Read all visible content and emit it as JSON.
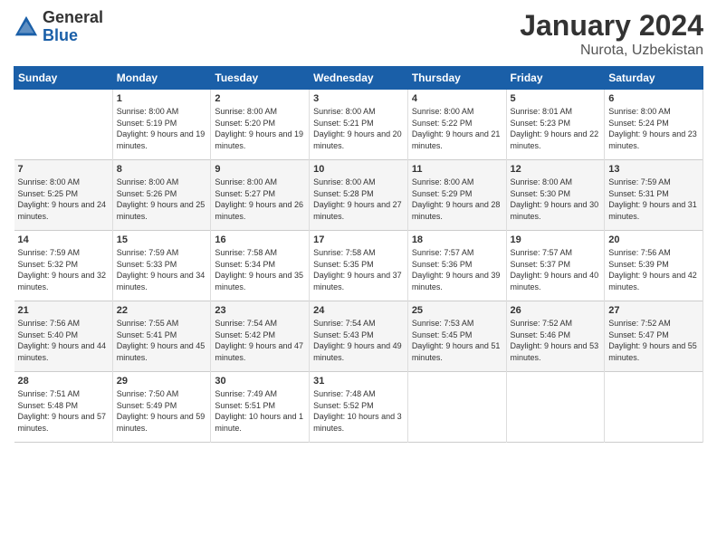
{
  "header": {
    "logo_general": "General",
    "logo_blue": "Blue",
    "month_title": "January 2024",
    "location": "Nurota, Uzbekistan"
  },
  "weekdays": [
    "Sunday",
    "Monday",
    "Tuesday",
    "Wednesday",
    "Thursday",
    "Friday",
    "Saturday"
  ],
  "weeks": [
    [
      {
        "day": "",
        "sunrise": "",
        "sunset": "",
        "daylight": ""
      },
      {
        "day": "1",
        "sunrise": "Sunrise: 8:00 AM",
        "sunset": "Sunset: 5:19 PM",
        "daylight": "Daylight: 9 hours and 19 minutes."
      },
      {
        "day": "2",
        "sunrise": "Sunrise: 8:00 AM",
        "sunset": "Sunset: 5:20 PM",
        "daylight": "Daylight: 9 hours and 19 minutes."
      },
      {
        "day": "3",
        "sunrise": "Sunrise: 8:00 AM",
        "sunset": "Sunset: 5:21 PM",
        "daylight": "Daylight: 9 hours and 20 minutes."
      },
      {
        "day": "4",
        "sunrise": "Sunrise: 8:00 AM",
        "sunset": "Sunset: 5:22 PM",
        "daylight": "Daylight: 9 hours and 21 minutes."
      },
      {
        "day": "5",
        "sunrise": "Sunrise: 8:01 AM",
        "sunset": "Sunset: 5:23 PM",
        "daylight": "Daylight: 9 hours and 22 minutes."
      },
      {
        "day": "6",
        "sunrise": "Sunrise: 8:00 AM",
        "sunset": "Sunset: 5:24 PM",
        "daylight": "Daylight: 9 hours and 23 minutes."
      }
    ],
    [
      {
        "day": "7",
        "sunrise": "Sunrise: 8:00 AM",
        "sunset": "Sunset: 5:25 PM",
        "daylight": "Daylight: 9 hours and 24 minutes."
      },
      {
        "day": "8",
        "sunrise": "Sunrise: 8:00 AM",
        "sunset": "Sunset: 5:26 PM",
        "daylight": "Daylight: 9 hours and 25 minutes."
      },
      {
        "day": "9",
        "sunrise": "Sunrise: 8:00 AM",
        "sunset": "Sunset: 5:27 PM",
        "daylight": "Daylight: 9 hours and 26 minutes."
      },
      {
        "day": "10",
        "sunrise": "Sunrise: 8:00 AM",
        "sunset": "Sunset: 5:28 PM",
        "daylight": "Daylight: 9 hours and 27 minutes."
      },
      {
        "day": "11",
        "sunrise": "Sunrise: 8:00 AM",
        "sunset": "Sunset: 5:29 PM",
        "daylight": "Daylight: 9 hours and 28 minutes."
      },
      {
        "day": "12",
        "sunrise": "Sunrise: 8:00 AM",
        "sunset": "Sunset: 5:30 PM",
        "daylight": "Daylight: 9 hours and 30 minutes."
      },
      {
        "day": "13",
        "sunrise": "Sunrise: 7:59 AM",
        "sunset": "Sunset: 5:31 PM",
        "daylight": "Daylight: 9 hours and 31 minutes."
      }
    ],
    [
      {
        "day": "14",
        "sunrise": "Sunrise: 7:59 AM",
        "sunset": "Sunset: 5:32 PM",
        "daylight": "Daylight: 9 hours and 32 minutes."
      },
      {
        "day": "15",
        "sunrise": "Sunrise: 7:59 AM",
        "sunset": "Sunset: 5:33 PM",
        "daylight": "Daylight: 9 hours and 34 minutes."
      },
      {
        "day": "16",
        "sunrise": "Sunrise: 7:58 AM",
        "sunset": "Sunset: 5:34 PM",
        "daylight": "Daylight: 9 hours and 35 minutes."
      },
      {
        "day": "17",
        "sunrise": "Sunrise: 7:58 AM",
        "sunset": "Sunset: 5:35 PM",
        "daylight": "Daylight: 9 hours and 37 minutes."
      },
      {
        "day": "18",
        "sunrise": "Sunrise: 7:57 AM",
        "sunset": "Sunset: 5:36 PM",
        "daylight": "Daylight: 9 hours and 39 minutes."
      },
      {
        "day": "19",
        "sunrise": "Sunrise: 7:57 AM",
        "sunset": "Sunset: 5:37 PM",
        "daylight": "Daylight: 9 hours and 40 minutes."
      },
      {
        "day": "20",
        "sunrise": "Sunrise: 7:56 AM",
        "sunset": "Sunset: 5:39 PM",
        "daylight": "Daylight: 9 hours and 42 minutes."
      }
    ],
    [
      {
        "day": "21",
        "sunrise": "Sunrise: 7:56 AM",
        "sunset": "Sunset: 5:40 PM",
        "daylight": "Daylight: 9 hours and 44 minutes."
      },
      {
        "day": "22",
        "sunrise": "Sunrise: 7:55 AM",
        "sunset": "Sunset: 5:41 PM",
        "daylight": "Daylight: 9 hours and 45 minutes."
      },
      {
        "day": "23",
        "sunrise": "Sunrise: 7:54 AM",
        "sunset": "Sunset: 5:42 PM",
        "daylight": "Daylight: 9 hours and 47 minutes."
      },
      {
        "day": "24",
        "sunrise": "Sunrise: 7:54 AM",
        "sunset": "Sunset: 5:43 PM",
        "daylight": "Daylight: 9 hours and 49 minutes."
      },
      {
        "day": "25",
        "sunrise": "Sunrise: 7:53 AM",
        "sunset": "Sunset: 5:45 PM",
        "daylight": "Daylight: 9 hours and 51 minutes."
      },
      {
        "day": "26",
        "sunrise": "Sunrise: 7:52 AM",
        "sunset": "Sunset: 5:46 PM",
        "daylight": "Daylight: 9 hours and 53 minutes."
      },
      {
        "day": "27",
        "sunrise": "Sunrise: 7:52 AM",
        "sunset": "Sunset: 5:47 PM",
        "daylight": "Daylight: 9 hours and 55 minutes."
      }
    ],
    [
      {
        "day": "28",
        "sunrise": "Sunrise: 7:51 AM",
        "sunset": "Sunset: 5:48 PM",
        "daylight": "Daylight: 9 hours and 57 minutes."
      },
      {
        "day": "29",
        "sunrise": "Sunrise: 7:50 AM",
        "sunset": "Sunset: 5:49 PM",
        "daylight": "Daylight: 9 hours and 59 minutes."
      },
      {
        "day": "30",
        "sunrise": "Sunrise: 7:49 AM",
        "sunset": "Sunset: 5:51 PM",
        "daylight": "Daylight: 10 hours and 1 minute."
      },
      {
        "day": "31",
        "sunrise": "Sunrise: 7:48 AM",
        "sunset": "Sunset: 5:52 PM",
        "daylight": "Daylight: 10 hours and 3 minutes."
      },
      {
        "day": "",
        "sunrise": "",
        "sunset": "",
        "daylight": ""
      },
      {
        "day": "",
        "sunrise": "",
        "sunset": "",
        "daylight": ""
      },
      {
        "day": "",
        "sunrise": "",
        "sunset": "",
        "daylight": ""
      }
    ]
  ]
}
